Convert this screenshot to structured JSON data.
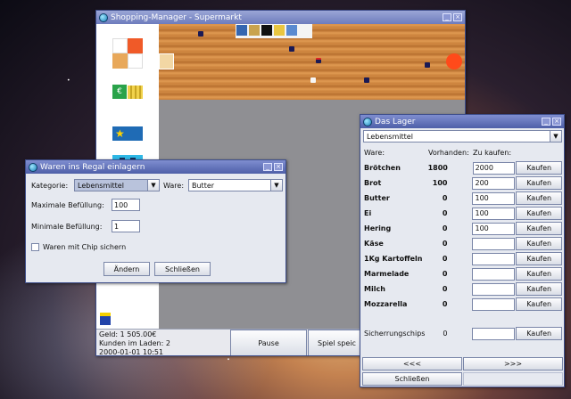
{
  "colors": {
    "titlebar": "#4e5fa8",
    "window_bg": "#e6e9f0",
    "floor": "#d48d45",
    "store_grey": "#8f8f93"
  },
  "shop": {
    "title": "Shopping-Manager - Supermarkt",
    "status": {
      "money": "Geld: 1 505.00€",
      "customers": "Kunden im Laden: 2",
      "datetime": "2000-01-01 10:51"
    },
    "pause_label": "Pause",
    "save_label": "Spiel speic"
  },
  "dialog": {
    "title": "Waren ins Regal einlagern",
    "category_label": "Kategorie:",
    "category_value": "Lebensmittel",
    "ware_label": "Ware:",
    "ware_value": "Butter",
    "max_label": "Maximale Befüllung:",
    "max_value": "100",
    "min_label": "Minimale Befüllung:",
    "min_value": "1",
    "chip_label": "Waren mit Chip sichern",
    "change_button": "Ändern",
    "close_button": "Schließen"
  },
  "lager": {
    "title": "Das Lager",
    "category": "Lebensmittel",
    "headers": {
      "ware": "Ware:",
      "have": "Vorhanden:",
      "buy": "Zu kaufen:"
    },
    "buy_label": "Kaufen",
    "items": [
      {
        "name": "Brötchen",
        "have": "1800",
        "buy": "2000"
      },
      {
        "name": "Brot",
        "have": "100",
        "buy": "200"
      },
      {
        "name": "Butter",
        "have": "0",
        "buy": "100"
      },
      {
        "name": "Ei",
        "have": "0",
        "buy": "100"
      },
      {
        "name": "Hering",
        "have": "0",
        "buy": "100"
      },
      {
        "name": "Käse",
        "have": "0",
        "buy": ""
      },
      {
        "name": "1Kg Kartoffeln",
        "have": "0",
        "buy": ""
      },
      {
        "name": "Marmelade",
        "have": "0",
        "buy": ""
      },
      {
        "name": "Milch",
        "have": "0",
        "buy": ""
      },
      {
        "name": "Mozzarella",
        "have": "0",
        "buy": ""
      }
    ],
    "chips": {
      "name": "Sicherrungschips",
      "have": "0",
      "buy": ""
    },
    "prev_label": "<<<",
    "next_label": ">>>",
    "close_label": "Schließen"
  }
}
